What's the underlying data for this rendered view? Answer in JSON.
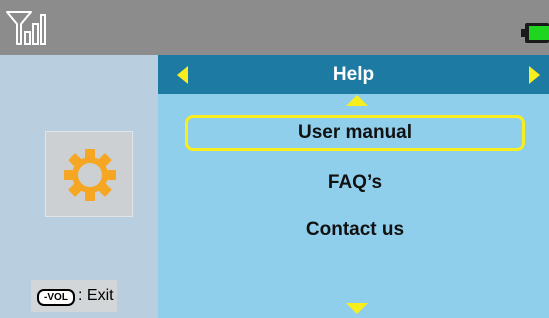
{
  "status_bar": {
    "signal_icon": "signal-bars-icon",
    "battery_icon": "battery-icon",
    "battery_color": "#1fd51f"
  },
  "sidebar": {
    "app_icon": "gear-icon",
    "app_icon_color": "#f5a623",
    "exit_hint": {
      "key_label": "-VOL",
      "label": ": Exit"
    }
  },
  "menu": {
    "title": "Help",
    "nav_left_icon": "arrow-left-icon",
    "nav_right_icon": "arrow-right-icon",
    "scroll_up_icon": "scroll-up-icon",
    "scroll_down_icon": "scroll-down-icon",
    "items": [
      {
        "label": "User manual",
        "selected": true
      },
      {
        "label": "FAQ’s",
        "selected": false
      },
      {
        "label": "Contact us",
        "selected": false
      }
    ]
  },
  "colors": {
    "header": "#1d7ba3",
    "panel": "#8fcfec",
    "accent": "#f8ee1e",
    "sidebar": "#b9cfe0",
    "status_bar": "#8c8c8c"
  }
}
